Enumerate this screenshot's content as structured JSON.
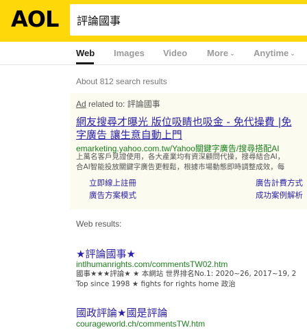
{
  "header": {
    "logo": "AOL",
    "search_value": "評論國事",
    "brand_color": "#ffd80a"
  },
  "tabs": [
    {
      "label": "Web",
      "active": true
    },
    {
      "label": "Images",
      "active": false
    },
    {
      "label": "Video",
      "active": false
    },
    {
      "label": "More",
      "active": false,
      "icon": "chevron-down-icon"
    },
    {
      "label": "Anytime",
      "active": false,
      "icon": "chevron-down-icon"
    }
  ],
  "results_count": "About 812 search results",
  "ad": {
    "tag": "Ad",
    "related_text": " related to: 評論國事",
    "title_line1": "網友搜尋才曝光 版位吸睛也吸金 - 免代操費 |免",
    "title_line2": "字廣告 讓生意自動上門",
    "url": "emarketing.yahoo.com.tw/Yahoo關鍵字廣告/搜尋搭配AI",
    "desc_line1": "上萬名客戶見證使用，各大產業均有資深顧問代操，搜尋結合AI，",
    "desc_line2": "合AI智能投放關鍵字廣告更輕鬆，根據市場動態即時調整成效，每",
    "sitelinks": [
      "立即線上註冊",
      "廣告計費方式",
      "廣告方案模式",
      "成功案例解析"
    ]
  },
  "web_results_label": "Web results:",
  "results": [
    {
      "title": "★評論國事★",
      "url": "intlhumanrights.com/commentsTW02.htm",
      "desc_line1": "國事★★★評論★ ★ 本網站 世界排名No.1: 2020~26, 2017~19, 2",
      "desc_line2": "Top since 1998 ★ fights for rights home 政治"
    },
    {
      "title": "國政評論★國是評論",
      "url": "courageworld.ch/commentsTW.htm"
    }
  ]
}
